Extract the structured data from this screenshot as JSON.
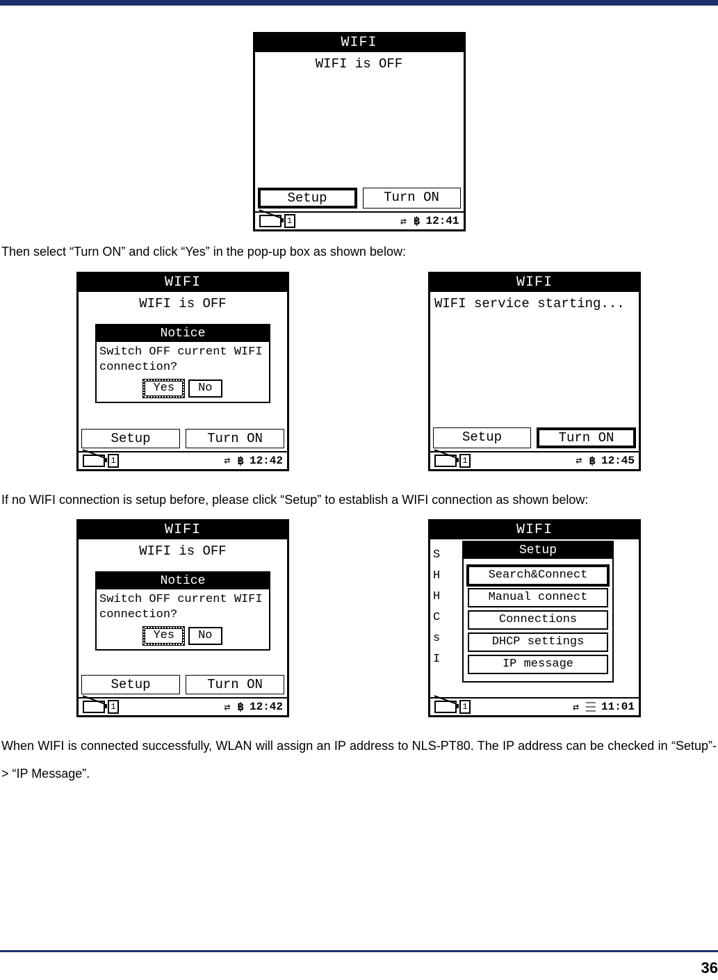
{
  "page_number": "36",
  "para1": "Then select “Turn ON” and click “Yes” in the pop-up box as shown below:",
  "para2": "If no WIFI connection is setup before, please click “Setup” to establish a WIFI connection as shown below:",
  "para3": "When WIFI is connected successfully, WLAN will assign an IP address to NLS-PT80. The IP address can be checked in “Setup”-> “IP Message”.",
  "screen1": {
    "title": "WIFI",
    "status": "WIFI is OFF",
    "btn_left": "Setup",
    "btn_right": "Turn ON",
    "signal": "1",
    "time": "12:41"
  },
  "screen2a": {
    "title": "WIFI",
    "status": "WIFI is OFF",
    "notice_title": "Notice",
    "notice_body": "Switch OFF current WIFI connection?",
    "notice_yes": "Yes",
    "notice_no": "No",
    "btn_left": "Setup",
    "btn_right": "Turn ON",
    "signal": "1",
    "time": "12:42"
  },
  "screen2b": {
    "title": "WIFI",
    "status": "WIFI service starting...",
    "btn_left": "Setup",
    "btn_right": "Turn ON",
    "signal": "1",
    "time": "12:45"
  },
  "screen3a": {
    "title": "WIFI",
    "status": "WIFI is OFF",
    "notice_title": "Notice",
    "notice_body": "Switch OFF current WIFI connection?",
    "notice_yes": "Yes",
    "notice_no": "No",
    "btn_left": "Setup",
    "btn_right": "Turn ON",
    "signal": "1",
    "time": "12:42"
  },
  "screen3b": {
    "title": "WIFI",
    "setup_title": "Setup",
    "items": [
      "Search&Connect",
      "Manual connect",
      "Connections",
      "DHCP settings",
      "IP message"
    ],
    "bg_letters": "S\nH\nH\nC\ns\nI",
    "signal": "1",
    "time": "11:01"
  },
  "icons": {
    "net": "⇄",
    "bt": "฿"
  }
}
